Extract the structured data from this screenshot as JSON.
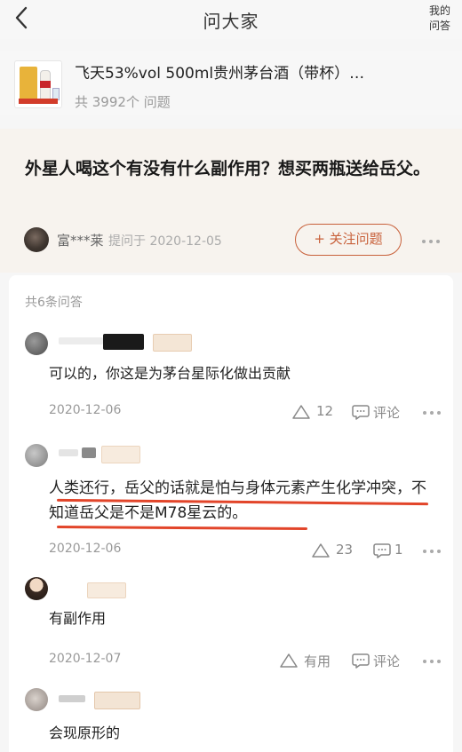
{
  "header": {
    "title": "问大家",
    "my_qa": "我的问答"
  },
  "product": {
    "name": "飞天53%vol 500ml贵州茅台酒（带杯）…",
    "count_text": "共 3992个 问题"
  },
  "question": {
    "text": "外星人喝这个有没有什么副作用？想买两瓶送给岳父。",
    "asker": "富***莱",
    "asked_date": "提问于 2020-12-05",
    "follow_label": "+ 关注问题"
  },
  "answers_section": {
    "count_label": "共6条问答",
    "items": [
      {
        "text": "可以的，你这是为茅台星际化做出贡献",
        "date": "2020-12-06",
        "likes": "12",
        "comment": "评论"
      },
      {
        "text": "人类还行，岳父的话就是怕与身体元素产生化学冲突，不知道岳父是不是M78星云的。",
        "date": "2020-12-06",
        "likes": "23",
        "comment": "1"
      },
      {
        "text": "有副作用",
        "date": "2020-12-07",
        "likes": "有用",
        "comment": "评论"
      },
      {
        "text": "会现原形的"
      }
    ]
  },
  "colors": {
    "accent": "#c8603a",
    "underline": "#e2452a",
    "question_bg": "#f7f3ee"
  },
  "icons": [
    "back-arrow-icon",
    "like-triangle-icon",
    "comment-bubble-icon",
    "more-dots-icon"
  ]
}
